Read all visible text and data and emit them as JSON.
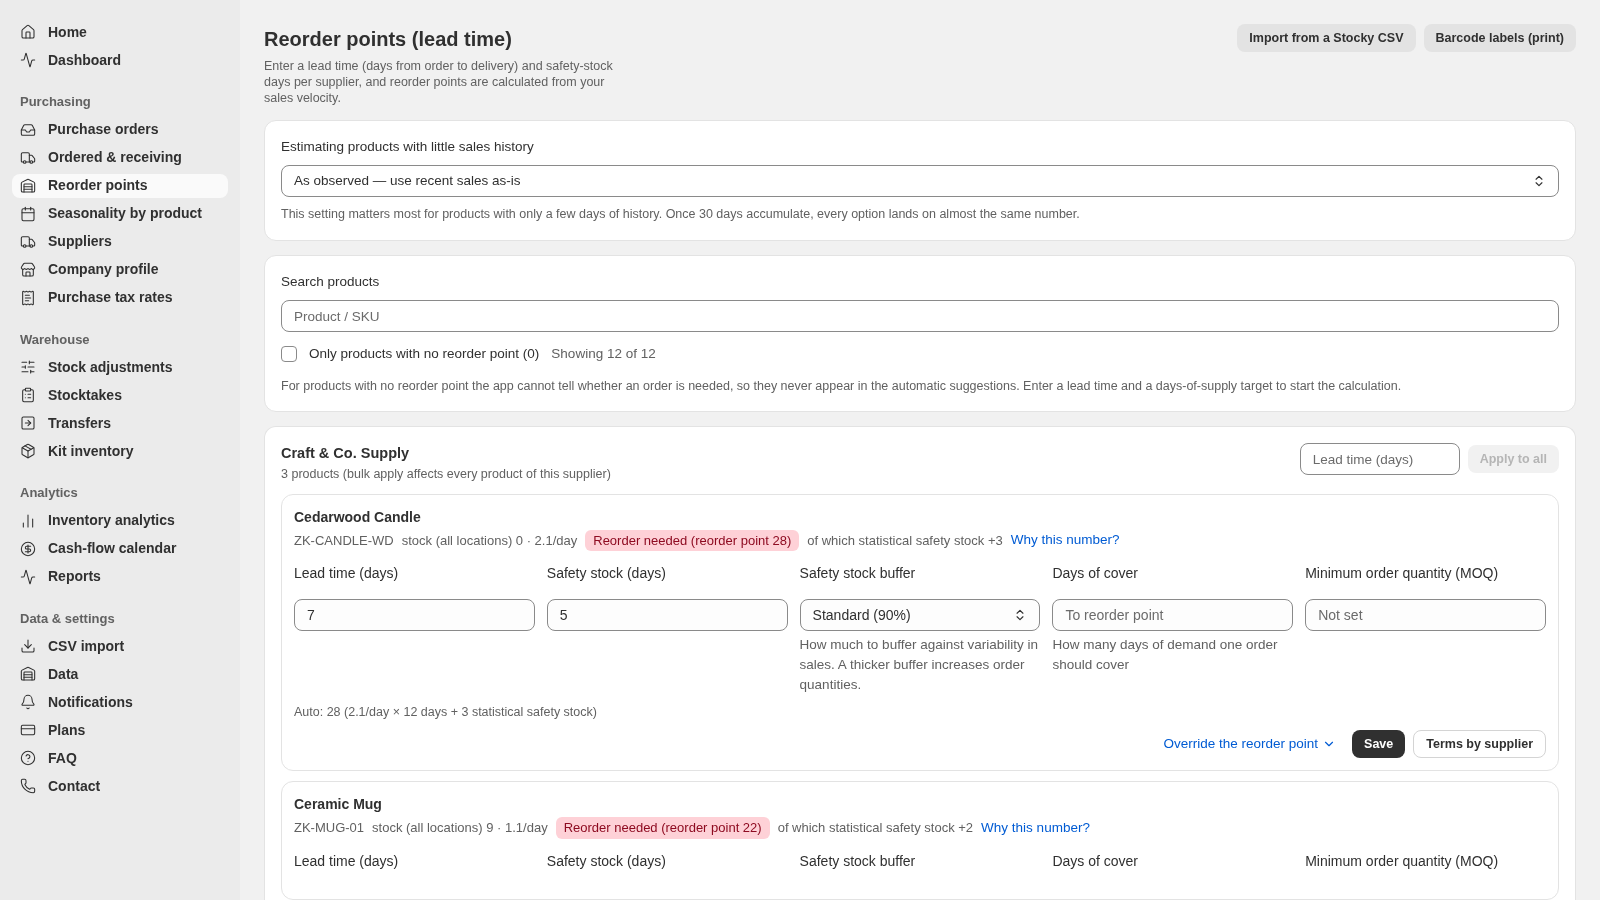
{
  "sidebar": {
    "groups": [
      {
        "items": [
          {
            "label": "Home",
            "selected": false
          },
          {
            "label": "Dashboard",
            "selected": false
          }
        ]
      },
      {
        "heading": "Purchasing",
        "items": [
          {
            "label": "Purchase orders",
            "selected": false
          },
          {
            "label": "Ordered & receiving",
            "selected": false
          },
          {
            "label": "Reorder points",
            "selected": true
          },
          {
            "label": "Seasonality by product",
            "selected": false
          },
          {
            "label": "Suppliers",
            "selected": false
          },
          {
            "label": "Company profile",
            "selected": false
          },
          {
            "label": "Purchase tax rates",
            "selected": false
          }
        ]
      },
      {
        "heading": "Warehouse",
        "items": [
          {
            "label": "Stock adjustments",
            "selected": false
          },
          {
            "label": "Stocktakes",
            "selected": false
          },
          {
            "label": "Transfers",
            "selected": false
          },
          {
            "label": "Kit inventory",
            "selected": false
          }
        ]
      },
      {
        "heading": "Analytics",
        "items": [
          {
            "label": "Inventory analytics",
            "selected": false
          },
          {
            "label": "Cash-flow calendar",
            "selected": false
          },
          {
            "label": "Reports",
            "selected": false
          }
        ]
      },
      {
        "heading": "Data & settings",
        "items": [
          {
            "label": "CSV import",
            "selected": false
          },
          {
            "label": "Data",
            "selected": false
          },
          {
            "label": "Notifications",
            "selected": false
          },
          {
            "label": "Plans",
            "selected": false
          },
          {
            "label": "FAQ",
            "selected": false
          },
          {
            "label": "Contact",
            "selected": false
          }
        ]
      }
    ]
  },
  "header": {
    "title": "Reorder points (lead time)",
    "description": "Enter a lead time (days from order to delivery) and safety-stock days per supplier, and reorder points are calculated from your sales velocity.",
    "buttons": [
      "Import from a Stocky CSV",
      "Barcode labels (print)"
    ]
  },
  "estimation": {
    "label": "Estimating products with little sales history",
    "value": "As observed — use recent sales as-is",
    "hint": "This setting matters most for products with only a few days of history. Once 30 days accumulate, every option lands on almost the same number."
  },
  "search": {
    "label": "Search products",
    "placeholder": "Product / SKU",
    "filter": {
      "label": "Only products with no reorder point (0)",
      "checked": false
    },
    "count": "Showing 12 of 12",
    "note": "For products with no reorder point the app cannot tell whether an order is needed, so they never appear in the automatic suggestions. Enter a lead time and a days-of-supply target to start the calculation."
  },
  "supplier": {
    "name": "Craft & Co. Supply",
    "subtitle": "3 products (bulk apply affects every product of this supplier)",
    "bulk_placeholder": "Lead time (days)",
    "apply": {
      "label": "Apply to all",
      "disabled": true
    },
    "products": [
      {
        "name": "Cedarwood Candle",
        "sku": "ZK-CANDLE-WD",
        "stock": "stock (all locations) 0 · 2.1/day",
        "badge": "Reorder needed (reorder point 28)",
        "safety": "of which statistical safety stock +3",
        "link": "Why this number?",
        "fields": [
          {
            "kind": "input",
            "label": "Lead time (days)",
            "value": "7"
          },
          {
            "kind": "input",
            "label": "Safety stock (days)",
            "value": "5"
          },
          {
            "kind": "select",
            "label": "Safety stock buffer",
            "value": "Standard (90%)",
            "hint": "How much to buffer against variability in sales. A thicker buffer increases order quantities."
          },
          {
            "kind": "input",
            "label": "Days of cover",
            "placeholder": "To reorder point",
            "hint": "How many days of demand one order should cover"
          },
          {
            "kind": "input",
            "label": "Minimum order quantity (MOQ)",
            "placeholder": "Not set"
          }
        ],
        "auto": "Auto: 28 (2.1/day × 12 days + 3 statistical safety stock)",
        "override": "Override the reorder point",
        "save": "Save",
        "terms": "Terms by supplier"
      },
      {
        "name": "Ceramic Mug",
        "sku": "ZK-MUG-01",
        "stock": "stock (all locations) 9 · 1.1/day",
        "badge": "Reorder needed (reorder point 22)",
        "safety": "of which statistical safety stock +2",
        "link": "Why this number?",
        "fields": [
          {
            "kind": "input",
            "label": "Lead time (days)"
          },
          {
            "kind": "input",
            "label": "Safety stock (days)"
          },
          {
            "kind": "select",
            "label": "Safety stock buffer"
          },
          {
            "kind": "input",
            "label": "Days of cover"
          },
          {
            "kind": "input",
            "label": "Minimum order quantity (MOQ)"
          }
        ]
      }
    ]
  }
}
